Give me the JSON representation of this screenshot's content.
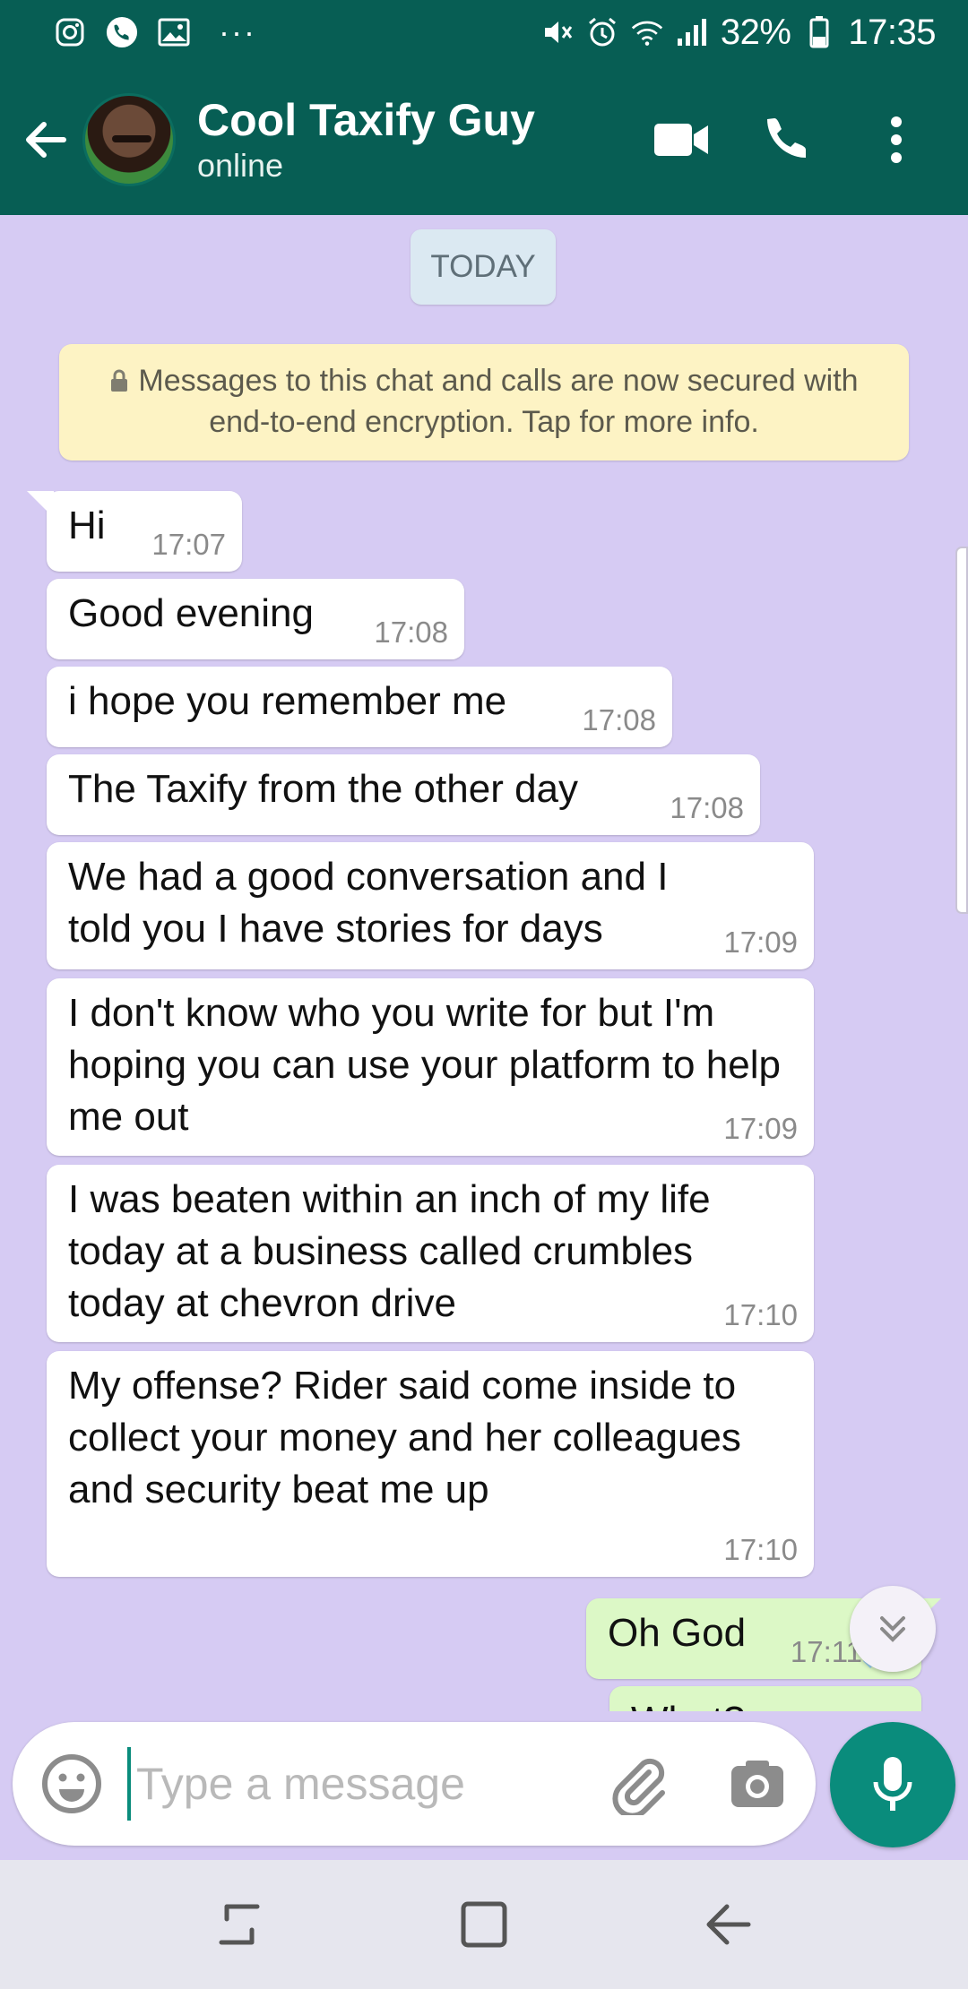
{
  "status_bar": {
    "battery": "32%",
    "time": "17:35",
    "more": "···"
  },
  "header": {
    "contact_name": "Cool Taxify Guy",
    "contact_status": "online"
  },
  "chat": {
    "day_label": "TODAY",
    "encryption_notice": "Messages to this chat and calls are now secured with end-to-end encryption. Tap for more info.",
    "messages": [
      {
        "direction": "in",
        "text": "Hi",
        "time": "17:07"
      },
      {
        "direction": "in",
        "text": "Good evening",
        "time": "17:08"
      },
      {
        "direction": "in",
        "text": "i hope you remember me",
        "time": "17:08"
      },
      {
        "direction": "in",
        "text": "The Taxify from the other day",
        "time": "17:08"
      },
      {
        "direction": "in",
        "text": "We had a good conversation and I told you I have stories for days",
        "time": "17:09"
      },
      {
        "direction": "in",
        "text": "I don't know who you write for but I'm hoping you can use your platform to help me out",
        "time": "17:09"
      },
      {
        "direction": "in",
        "text": "I was beaten within an inch of my life today at a business called crumbles today at chevron drive",
        "time": "17:10"
      },
      {
        "direction": "in",
        "text": "My offense? Rider said come inside to collect your money and her colleagues and security beat me up",
        "time": "17:10"
      },
      {
        "direction": "out",
        "text": "Oh God",
        "time": "17:11"
      },
      {
        "direction": "out",
        "text": "What?",
        "time": ""
      }
    ]
  },
  "composer": {
    "placeholder": "Type a message"
  },
  "colors": {
    "header_bg": "#075e54",
    "chat_bg": "#d6cbf3",
    "incoming_bubble": "#ffffff",
    "outgoing_bubble": "#dcf8c6",
    "accent": "#0a8c7c",
    "notice_bg": "#fdf3c4"
  },
  "icons": [
    "instagram-icon",
    "phone-status-icon",
    "gallery-icon",
    "mute-icon",
    "alarm-icon",
    "wifi-icon",
    "signal-icon",
    "battery-icon",
    "back-arrow-icon",
    "video-call-icon",
    "voice-call-icon",
    "more-vert-icon",
    "lock-icon",
    "double-check-icon",
    "chevron-double-down-icon",
    "emoji-icon",
    "paperclip-icon",
    "camera-icon",
    "mic-icon",
    "recents-icon",
    "home-icon",
    "nav-back-icon"
  ]
}
